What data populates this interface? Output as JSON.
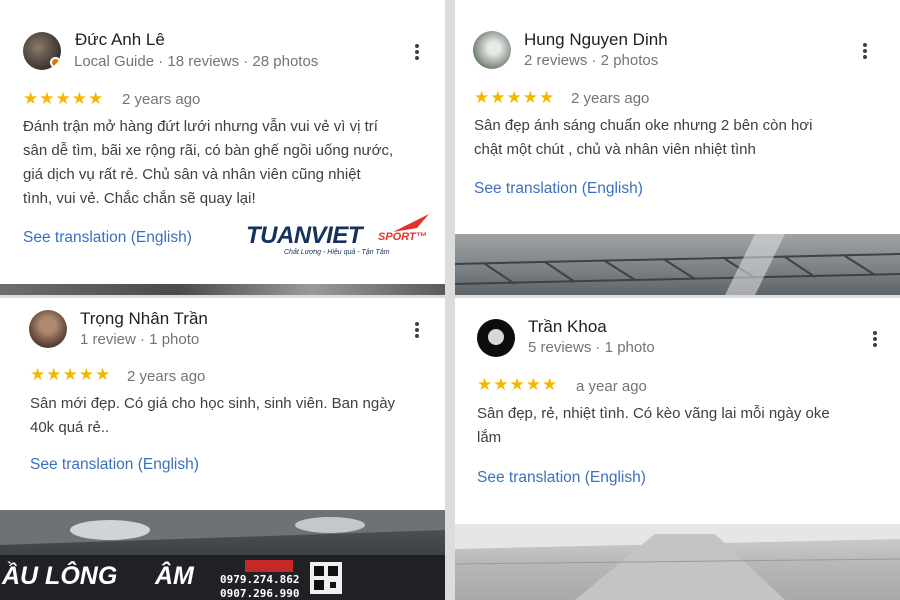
{
  "reviews": [
    {
      "name": "Đức Anh Lê",
      "meta": "Local Guide · 18 reviews · 28 photos",
      "rating": 5,
      "stars": "★★★★★",
      "when": "2 years ago",
      "text_lines": [
        "Đánh trận mở hàng đứt lưới nhưng vẫn vui vẻ vì vị trí",
        "sân dễ tìm, bãi xe rộng rãi, có bàn ghế ngồi uống nước,",
        "giá dịch vụ rất rẻ. Chủ sân và nhân viên cũng nhiệt",
        "tình, vui vẻ. Chắc chắn sẽ quay lại!"
      ],
      "translation_link": "See translation (English)"
    },
    {
      "name": "Hung Nguyen Dinh",
      "meta": "2 reviews · 2 photos",
      "rating": 5,
      "stars": "★★★★★",
      "when": "2 years ago",
      "text_lines": [
        "Sân đẹp ánh sáng chuẩn oke nhưng 2 bên còn hơi",
        "chật một chút , chủ và nhân viên nhiệt tình"
      ],
      "translation_link": "See translation (English)"
    },
    {
      "name": "Trọng Nhân Trần",
      "meta": "1 review · 1 photo",
      "rating": 5,
      "stars": "★★★★★",
      "when": "2 years ago",
      "text_lines": [
        "Sân mới đẹp. Có giá cho học sinh, sinh viên. Ban ngày",
        "40k quá rẻ.."
      ],
      "translation_link": "See translation (English)"
    },
    {
      "name": "Trần Khoa",
      "meta": "5 reviews · 1 photo",
      "rating": 5,
      "stars": "★★★★★",
      "when": "a year ago",
      "text_lines": [
        "Sân đẹp, rẻ, nhiệt tình. Có kèo vãng lai mỗi ngày oke",
        "lắm"
      ],
      "translation_link": "See translation (English)"
    }
  ],
  "watermark": {
    "brand": "TUANVIET",
    "brand_suffix": "SPORT™",
    "tagline": "Chất Lượng - Hiệu quả - Tận Tâm"
  },
  "banner": {
    "left_text": "ẦU LÔNG",
    "right_text": "ÂM",
    "phone_1": "0979.274.862",
    "phone_2": "0907.296.990"
  },
  "colors": {
    "star": "#f5b800",
    "link": "#3b6fbf",
    "brand_navy": "#16325c",
    "brand_red": "#e4322b"
  }
}
